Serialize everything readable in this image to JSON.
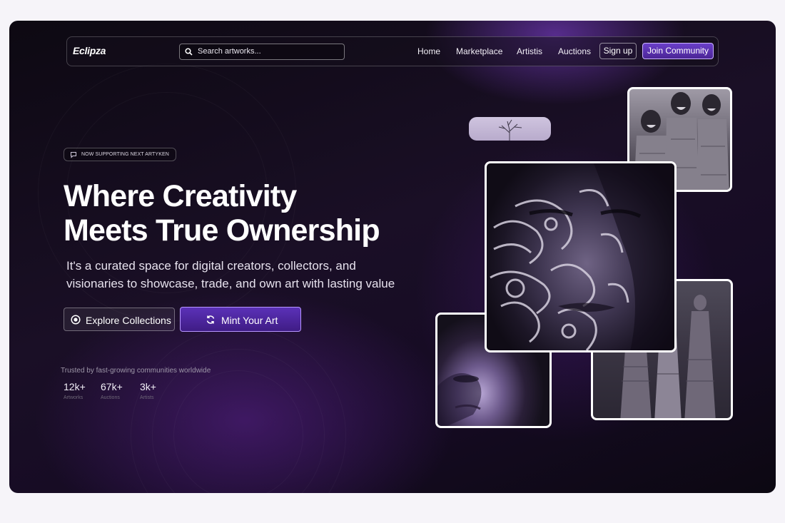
{
  "nav": {
    "logo": "Eclipza",
    "search_placeholder": "Search artworks...",
    "links": [
      "Home",
      "Marketplace",
      "Artistis",
      "Auctions"
    ],
    "sign_up": "Sign up",
    "join": "Join Community"
  },
  "hero": {
    "badge": "NOW SUPPORTING NEXT ARTYKEN",
    "headline_line1": "Where Creativity",
    "headline_line2": "Meets True Ownership",
    "subtitle_line1": "It's a curated space for digital creators, collectors, and",
    "subtitle_line2": "visionaries to showcase, trade, and own art with lasting value",
    "explore_label": "Explore Collections",
    "mint_label": "Mint Your Art",
    "trusted_text": "Trusted by fast-growing communities worldwide",
    "stats": [
      {
        "value": "12k+",
        "label": "Artworks"
      },
      {
        "value": "67k+",
        "label": "Auctions"
      },
      {
        "value": "3k+",
        "label": "Artists"
      }
    ]
  },
  "colors": {
    "accent": "#5b31b8",
    "accent_border": "#b796ff",
    "background": "#150c20"
  },
  "icons": [
    "search-icon",
    "chat-bubble-icon",
    "target-icon",
    "refresh-icon"
  ]
}
